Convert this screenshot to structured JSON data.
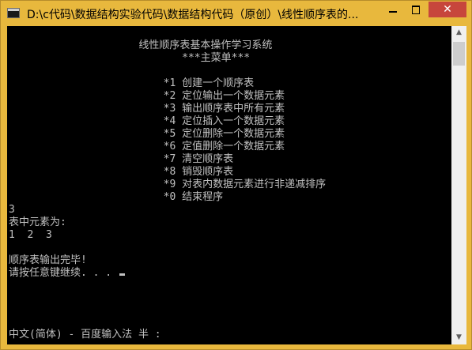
{
  "window": {
    "title": "D:\\c代码\\数据结构实验代码\\数据结构代码（原创）\\线性顺序表的...",
    "close_glyph": "✕"
  },
  "console": {
    "lines": [
      "                     线性顺序表基本操作学习系统",
      "                            ***主菜单***",
      "",
      "                         *1 创建一个顺序表",
      "                         *2 定位输出一个数据元素",
      "                         *3 输出顺序表中所有元素",
      "                         *4 定位插入一个数据元素",
      "                         *5 定位删除一个数据元素",
      "                         *6 定值删除一个数据元素",
      "                         *7 清空顺序表",
      "                         *8 销毁顺序表",
      "                         *9 对表内数据元素进行非递减排序",
      "                         *0 结束程序",
      "3",
      "表中元素为:",
      "1  2  3",
      "",
      "顺序表输出完毕!",
      "请按任意键继续. . . "
    ],
    "ime_status": "中文(简体) - 百度输入法 半 :"
  },
  "scrollbar": {
    "up_glyph": "▲",
    "down_glyph": "▼"
  }
}
